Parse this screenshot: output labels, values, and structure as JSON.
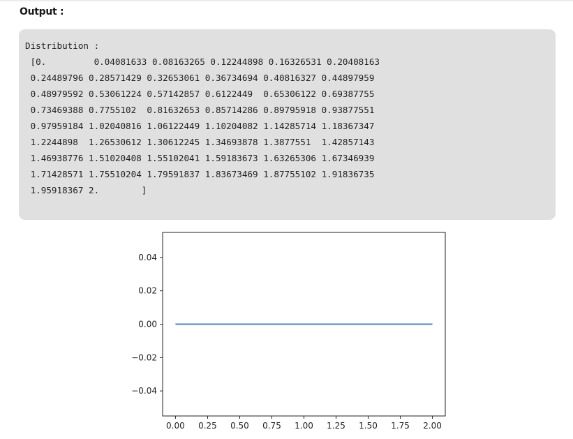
{
  "heading": "Output :",
  "output_text": "Distribution :\n [0.         0.04081633 0.08163265 0.12244898 0.16326531 0.20408163\n 0.24489796 0.28571429 0.32653061 0.36734694 0.40816327 0.44897959\n 0.48979592 0.53061224 0.57142857 0.6122449  0.65306122 0.69387755\n 0.73469388 0.7755102  0.81632653 0.85714286 0.89795918 0.93877551\n 0.97959184 1.02040816 1.06122449 1.10204082 1.14285714 1.18367347\n 1.2244898  1.26530612 1.30612245 1.34693878 1.3877551  1.42857143\n 1.46938776 1.51020408 1.55102041 1.59183673 1.63265306 1.67346939\n 1.71428571 1.75510204 1.79591837 1.83673469 1.87755102 1.91836735\n 1.95918367 2.        ]",
  "chart_data": {
    "type": "line",
    "x": [
      0.0,
      2.0
    ],
    "series": [
      {
        "values": [
          0.0,
          0.0
        ],
        "color": "#4a86c8"
      }
    ],
    "xlim": [
      -0.1,
      2.1
    ],
    "ylim": [
      -0.055,
      0.055
    ],
    "xticks": [
      0.0,
      0.25,
      0.5,
      0.75,
      1.0,
      1.25,
      1.5,
      1.75,
      2.0
    ],
    "xtick_labels": [
      "0.00",
      "0.25",
      "0.50",
      "0.75",
      "1.00",
      "1.25",
      "1.50",
      "1.75",
      "2.00"
    ],
    "yticks": [
      0.04,
      0.02,
      0.0,
      -0.02,
      -0.04
    ],
    "ytick_labels": [
      "0.04",
      "0.02",
      "0.00",
      "−0.02",
      "−0.04"
    ],
    "grid": false,
    "title": "",
    "xlabel": "",
    "ylabel": ""
  }
}
